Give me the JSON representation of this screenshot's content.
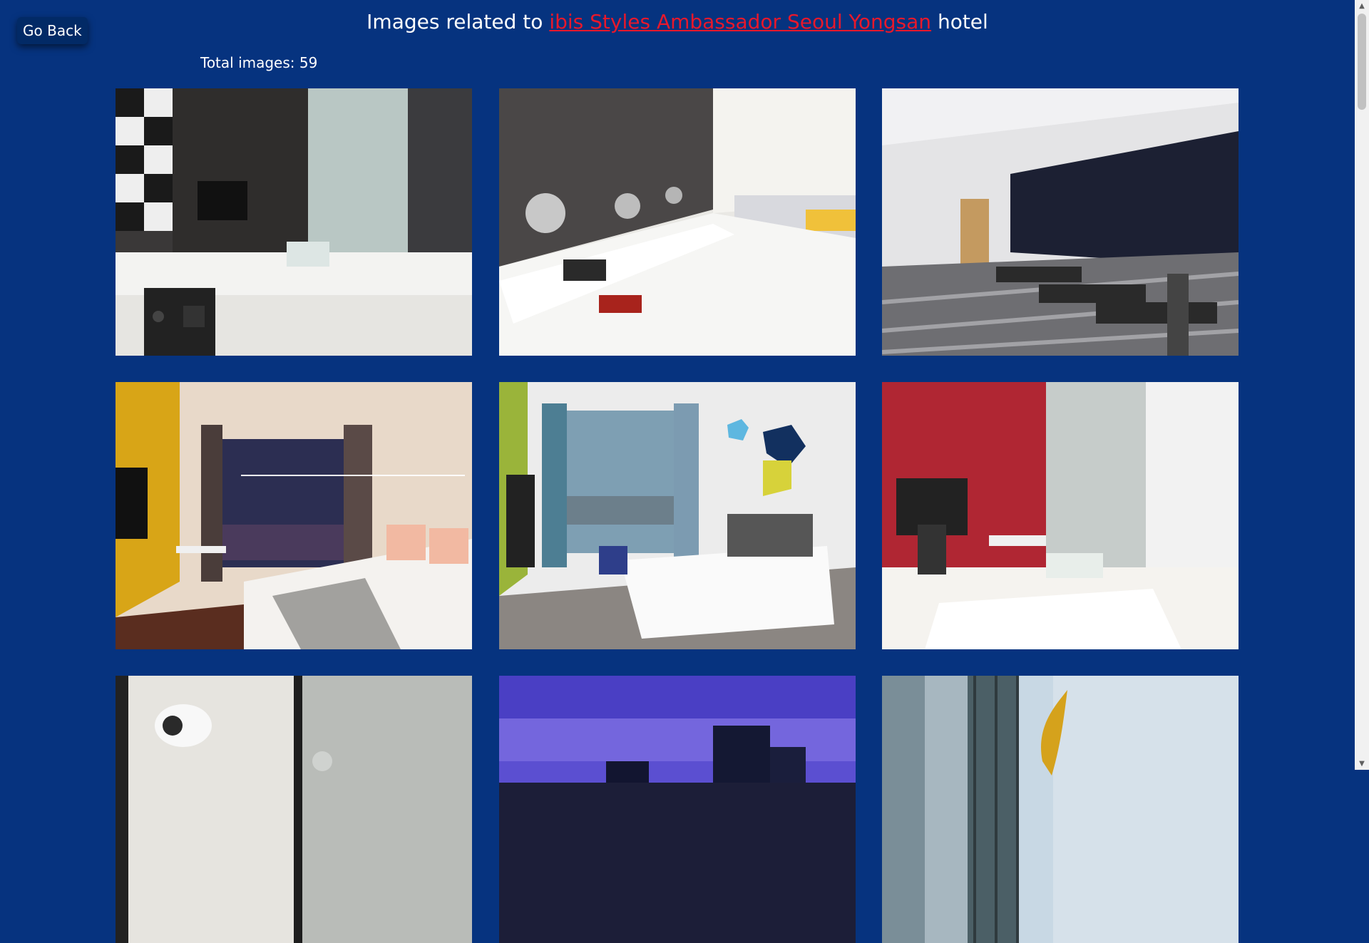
{
  "nav": {
    "back_label": "Go Back"
  },
  "header": {
    "prefix": "Images related to",
    "hotel_name": "ibis Styles Ambassador Seoul Yongsan",
    "suffix": "hotel"
  },
  "gallery": {
    "total_label": "Total images: 59",
    "images": [
      {
        "subject": "bathroom vanity with safe"
      },
      {
        "subject": "buffet restaurant"
      },
      {
        "subject": "fitness center"
      },
      {
        "subject": "guest room with yellow wall"
      },
      {
        "subject": "guest room with puzzle wall art"
      },
      {
        "subject": "bathroom with red wall"
      },
      {
        "subject": "bathroom hair dryer"
      },
      {
        "subject": "hotel exterior at dusk"
      },
      {
        "subject": "building exterior with sculpture"
      }
    ]
  },
  "scrollbar": {
    "up_icon": "▲",
    "down_icon": "▼"
  },
  "colors": {
    "background": "#06337f",
    "link": "#e8182b",
    "button": "#022a66"
  }
}
